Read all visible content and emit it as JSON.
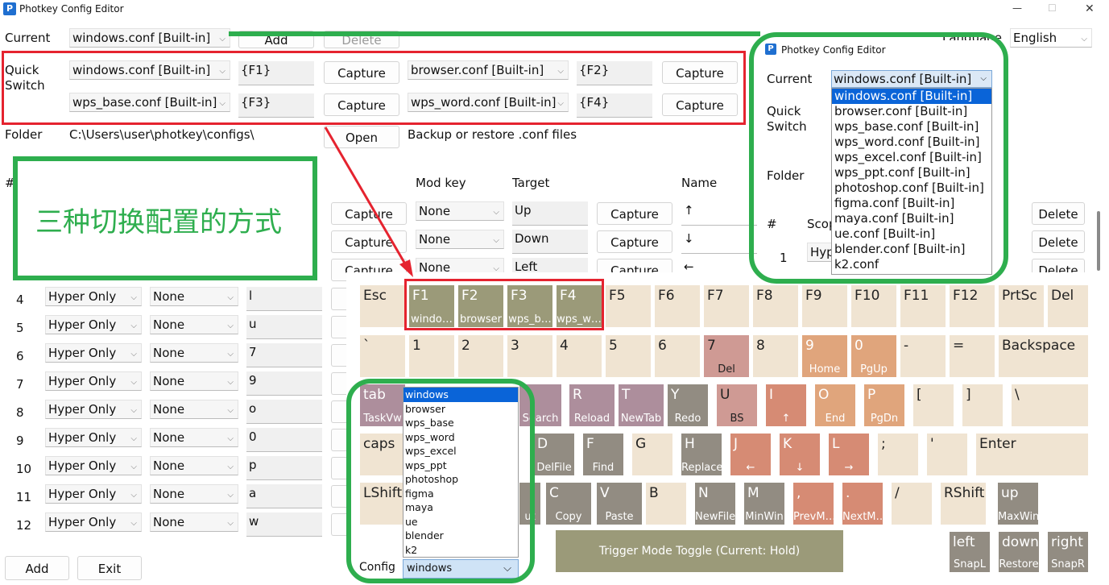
{
  "window": {
    "title": "Photkey Config Editor",
    "minimize": "—",
    "maximize": "☐",
    "close": "✕"
  },
  "top": {
    "current_label": "Current",
    "current_value": "windows.conf [Built-in]",
    "add_button": "Add",
    "delete_button": "Delete",
    "language_label": "Language",
    "language_value": "English"
  },
  "quick_switch": {
    "label_line1": "Quick",
    "label_line2": "Switch",
    "slots": [
      {
        "config": "windows.conf [Built-in]",
        "hotkey": "{F1}",
        "capture": "Capture"
      },
      {
        "config": "browser.conf [Built-in]",
        "hotkey": "{F2}",
        "capture": "Capture"
      },
      {
        "config": "wps_base.conf [Built-in]",
        "hotkey": "{F3}",
        "capture": "Capture"
      },
      {
        "config": "wps_word.conf [Built-in]",
        "hotkey": "{F4}",
        "capture": "Capture"
      }
    ]
  },
  "folder": {
    "label": "Folder",
    "path": "C:\\Users\\user\\photkey\\configs\\",
    "open_button": "Open",
    "hint": "Backup or restore .conf files"
  },
  "table": {
    "hash_header": "#",
    "headers": {
      "mod_key": "Mod key",
      "target": "Target",
      "name": "Name"
    },
    "top_rows": [
      {
        "capture": "Capture",
        "mod": "None",
        "target": "Up",
        "capture2": "Capture",
        "name": "↑",
        "delete": "Delete"
      },
      {
        "capture": "Capture",
        "mod": "None",
        "target": "Down",
        "capture2": "Capture",
        "name": "↓",
        "delete": "Delete"
      },
      {
        "capture": "Capture",
        "mod": "None",
        "target": "Left",
        "capture2": "Capture",
        "name": "←",
        "delete": "Delete"
      }
    ],
    "rows": [
      {
        "num": "4",
        "scope": "Hyper Only",
        "mod": "None",
        "key": "l"
      },
      {
        "num": "5",
        "scope": "Hyper Only",
        "mod": "None",
        "key": "u"
      },
      {
        "num": "6",
        "scope": "Hyper Only",
        "mod": "None",
        "key": "7"
      },
      {
        "num": "7",
        "scope": "Hyper Only",
        "mod": "None",
        "key": "9"
      },
      {
        "num": "8",
        "scope": "Hyper Only",
        "mod": "None",
        "key": "o"
      },
      {
        "num": "9",
        "scope": "Hyper Only",
        "mod": "None",
        "key": "0"
      },
      {
        "num": "10",
        "scope": "Hyper Only",
        "mod": "None",
        "key": "p"
      },
      {
        "num": "11",
        "scope": "Hyper Only",
        "mod": "None",
        "key": "a"
      },
      {
        "num": "12",
        "scope": "Hyper Only",
        "mod": "None",
        "key": "w"
      }
    ]
  },
  "bottom": {
    "add_button": "Add",
    "exit_button": "Exit"
  },
  "annotation": {
    "text": "三种切换配置的方式"
  },
  "inset": {
    "title": "Photkey Config Editor",
    "current_label": "Current",
    "current_value": "windows.conf [Built-in]",
    "quick_line1": "Quick",
    "quick_line2": "Switch",
    "folder_label": "Folder",
    "hash_label": "#",
    "scope_label": "Scop",
    "row_num": "1",
    "row_scope": "Hyp",
    "options": [
      "windows.conf [Built-in]",
      "browser.conf [Built-in]",
      "wps_base.conf [Built-in]",
      "wps_word.conf [Built-in]",
      "wps_excel.conf [Built-in]",
      "wps_ppt.conf [Built-in]",
      "photoshop.conf [Built-in]",
      "figma.conf [Built-in]",
      "maya.conf [Built-in]",
      "ue.conf [Built-in]",
      "blender.conf [Built-in]",
      "k2.conf"
    ]
  },
  "keyboard": {
    "row1": [
      {
        "main": "Esc",
        "sub": ""
      },
      {
        "main": "F1",
        "sub": "windo…"
      },
      {
        "main": "F2",
        "sub": "browser"
      },
      {
        "main": "F3",
        "sub": "wps_b…"
      },
      {
        "main": "F4",
        "sub": "wps_w…"
      },
      {
        "main": "F5",
        "sub": ""
      },
      {
        "main": "F6",
        "sub": ""
      },
      {
        "main": "F7",
        "sub": ""
      },
      {
        "main": "F8",
        "sub": ""
      },
      {
        "main": "F9",
        "sub": ""
      },
      {
        "main": "F10",
        "sub": ""
      },
      {
        "main": "F11",
        "sub": ""
      },
      {
        "main": "F12",
        "sub": ""
      },
      {
        "main": "PrtSc",
        "sub": ""
      },
      {
        "main": "Del",
        "sub": ""
      }
    ],
    "row2": [
      {
        "main": "`",
        "sub": ""
      },
      {
        "main": "1",
        "sub": ""
      },
      {
        "main": "2",
        "sub": ""
      },
      {
        "main": "3",
        "sub": ""
      },
      {
        "main": "4",
        "sub": ""
      },
      {
        "main": "5",
        "sub": ""
      },
      {
        "main": "6",
        "sub": ""
      },
      {
        "main": "7",
        "sub": "Del"
      },
      {
        "main": "8",
        "sub": ""
      },
      {
        "main": "9",
        "sub": "Home"
      },
      {
        "main": "0",
        "sub": "PgUp"
      },
      {
        "main": "-",
        "sub": ""
      },
      {
        "main": "=",
        "sub": ""
      },
      {
        "main": "Backspace",
        "sub": ""
      }
    ],
    "row3": [
      {
        "main": "tab",
        "sub": "TaskVw"
      },
      {
        "main": "",
        "sub": "Search"
      },
      {
        "main": "R",
        "sub": "Reload"
      },
      {
        "main": "T",
        "sub": "NewTab"
      },
      {
        "main": "Y",
        "sub": "Redo"
      },
      {
        "main": "U",
        "sub": "BS"
      },
      {
        "main": "I",
        "sub": "↑"
      },
      {
        "main": "O",
        "sub": "End"
      },
      {
        "main": "P",
        "sub": "PgDn"
      },
      {
        "main": "[",
        "sub": ""
      },
      {
        "main": "]",
        "sub": ""
      },
      {
        "main": "\\",
        "sub": ""
      }
    ],
    "row4": [
      {
        "main": "caps",
        "sub": ""
      },
      {
        "main": "D",
        "sub": "DelFile"
      },
      {
        "main": "F",
        "sub": "Find"
      },
      {
        "main": "G",
        "sub": ""
      },
      {
        "main": "H",
        "sub": "Replace"
      },
      {
        "main": "J",
        "sub": "←"
      },
      {
        "main": "K",
        "sub": "↓"
      },
      {
        "main": "L",
        "sub": "→"
      },
      {
        "main": ";",
        "sub": ""
      },
      {
        "main": "'",
        "sub": ""
      },
      {
        "main": "Enter",
        "sub": ""
      }
    ],
    "row5": [
      {
        "main": "LShift",
        "sub": ""
      },
      {
        "main": "",
        "sub": "ut"
      },
      {
        "main": "C",
        "sub": "Copy"
      },
      {
        "main": "V",
        "sub": "Paste"
      },
      {
        "main": "B",
        "sub": ""
      },
      {
        "main": "N",
        "sub": "NewFile"
      },
      {
        "main": "M",
        "sub": "MinWin"
      },
      {
        "main": ",",
        "sub": "PrevM…"
      },
      {
        "main": ".",
        "sub": "NextM…"
      },
      {
        "main": "/",
        "sub": ""
      },
      {
        "main": "RShift",
        "sub": ""
      },
      {
        "main": "up",
        "sub": "MaxWin"
      }
    ],
    "row6": [
      {
        "main": "left",
        "sub": "SnapL"
      },
      {
        "main": "down",
        "sub": "Restore"
      },
      {
        "main": "right",
        "sub": "SnapR"
      }
    ],
    "trigger": "Trigger Mode Toggle (Current: Hold)",
    "config_label": "Config",
    "config_value": "windows",
    "config_options": [
      "windows",
      "browser",
      "wps_base",
      "wps_word",
      "wps_excel",
      "wps_ppt",
      "photoshop",
      "figma",
      "maya",
      "ue",
      "blender",
      "k2"
    ]
  },
  "colors": {
    "annotation_green": "#2eae4e",
    "annotation_red": "#e5232f",
    "selection_blue": "#0a64d8"
  }
}
